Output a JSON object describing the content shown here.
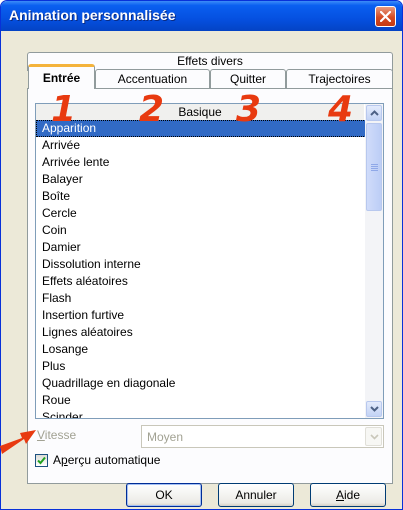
{
  "window": {
    "title": "Animation personnalisée"
  },
  "tabs": {
    "top_row": "Effets divers",
    "entree": "Entrée",
    "accentuation": "Accentuation",
    "quitter": "Quitter",
    "trajectoires": "Trajectoires"
  },
  "list": {
    "header": "Basique",
    "selected": "Apparition",
    "items": [
      "Apparition",
      "Arrivée",
      "Arrivée lente",
      "Balayer",
      "Boîte",
      "Cercle",
      "Coin",
      "Damier",
      "Dissolution interne",
      "Effets aléatoires",
      "Flash",
      "Insertion furtive",
      "Lignes aléatoires",
      "Losange",
      "Plus",
      "Quadrillage en diagonale",
      "Roue",
      "Scinder"
    ]
  },
  "speed": {
    "label": "Vitesse",
    "value": "Moyen"
  },
  "preview": {
    "label": "Aperçu automatique",
    "checked": true
  },
  "buttons": {
    "ok": "OK",
    "cancel": "Annuler",
    "help": "Aide"
  },
  "annotations": {
    "n1": "1",
    "n2": "2",
    "n3": "3",
    "n4": "4"
  },
  "colors": {
    "title_bar": "#0a5ff0",
    "selection": "#316ac5",
    "annotation": "#e83a10",
    "close_button": "#d44a22",
    "active_tab_accent": "#f4b33b"
  },
  "icons": {
    "close": "close-icon",
    "scroll_up": "chevron-up-icon",
    "scroll_down": "chevron-down-icon",
    "dropdown": "chevron-down-icon",
    "checkbox": "checkmark-icon",
    "pointer": "arrow-pointer-icon"
  }
}
